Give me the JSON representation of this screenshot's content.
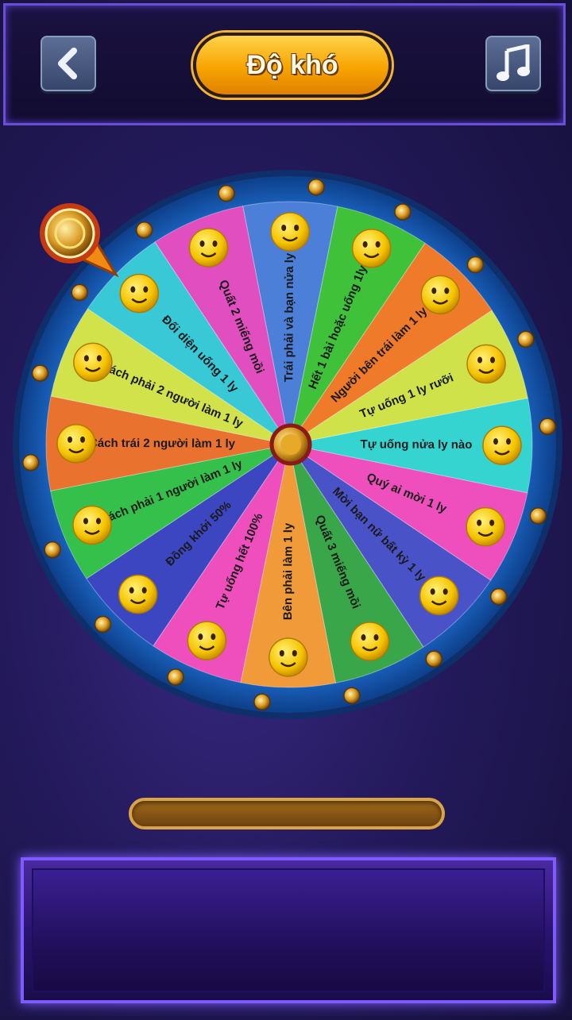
{
  "header": {
    "title": "Độ khó",
    "back_icon": "chevron-left-icon",
    "music_icon": "music-note-icon"
  },
  "wheel": {
    "segments": [
      {
        "label": "Trái phải và bạn nửa ly",
        "color": "#4b7fd8"
      },
      {
        "label": "Hết 1 bài hoặc uống 1ly",
        "color": "#3fc23a"
      },
      {
        "label": "Người bên trái làm 1 ly",
        "color": "#ee7a2a"
      },
      {
        "label": "Tự uống 1 ly rưỡi",
        "color": "#cfe24a"
      },
      {
        "label": "Tự uống nửa ly nào",
        "color": "#35d4d0"
      },
      {
        "label": "Quý ai mời 1 ly",
        "color": "#ee4fbd"
      },
      {
        "label": "Mời bạn nữ bất kỳ 1 ly",
        "color": "#4a52c8"
      },
      {
        "label": "Quất 3 miếng mồi",
        "color": "#3aa64a"
      },
      {
        "label": "Bên phải làm 1 ly",
        "color": "#f09a3a"
      },
      {
        "label": "Tự uống hết 100%",
        "color": "#ee4fbd"
      },
      {
        "label": "Đồng khởi 50%",
        "color": "#3b46c0"
      },
      {
        "label": "Cách phải 1 người làm 1 ly",
        "color": "#34c04a"
      },
      {
        "label": "Cách trái 2 người làm 1 ly",
        "color": "#e8722e"
      },
      {
        "label": "Cách phải 2 người làm 1 ly",
        "color": "#d2e24a"
      },
      {
        "label": "Đối diện uống 1 ly",
        "color": "#38c8d6"
      },
      {
        "label": "Quất 2 miếng mồi",
        "color": "#e04ec0"
      }
    ],
    "rim_color": "#2a7fd8",
    "emoji_icon": "smiley-face-icon",
    "pointer_icon": "gold-coin-pointer-icon"
  },
  "progress": {
    "value": 0
  }
}
